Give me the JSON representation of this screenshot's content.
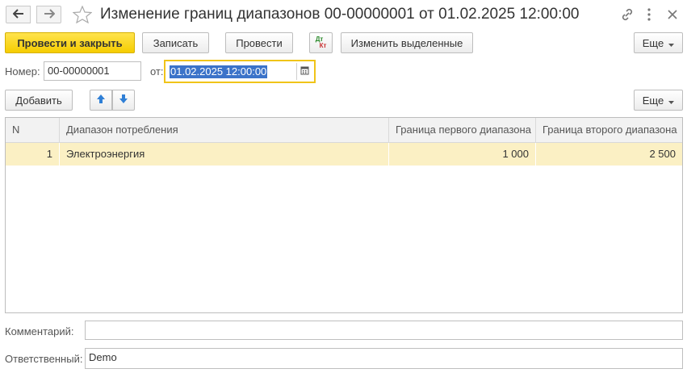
{
  "window": {
    "title": "Изменение границ диапазонов 00-00000001 от 01.02.2025 12:00:00"
  },
  "toolbar": {
    "post_and_close": "Провести и закрыть",
    "save": "Записать",
    "post": "Провести",
    "dt_kt_top": "Дт",
    "dt_kt_bottom": "Кт",
    "change_selected": "Изменить выделенные",
    "more": "Еще"
  },
  "header_fields": {
    "number_label": "Номер:",
    "number_value": "00-00000001",
    "date_label": "от:",
    "date_value": "01.02.2025 12:00:00"
  },
  "table_toolbar": {
    "add": "Добавить",
    "more": "Еще"
  },
  "table": {
    "columns": [
      "N",
      "Диапазон потребления",
      "Граница первого диапазона",
      "Граница второго диапазона"
    ],
    "rows": [
      [
        "1",
        "Электроэнергия",
        "1 000",
        "2 500"
      ]
    ]
  },
  "footer": {
    "comment_label": "Комментарий:",
    "comment_value": "",
    "responsible_label": "Ответственный:",
    "responsible_value": "Demo"
  },
  "colors": {
    "primary_button": "#f5cd00",
    "selected_row": "#fbf0c4",
    "date_highlight": "#3b73c9",
    "focus_border": "#f0c419"
  },
  "icons": [
    "arrow-left-icon",
    "arrow-right-icon",
    "star-icon",
    "link-icon",
    "more-vert-icon",
    "close-icon",
    "calendar-icon",
    "arrow-up-icon",
    "arrow-down-icon",
    "dropdown-icon"
  ]
}
